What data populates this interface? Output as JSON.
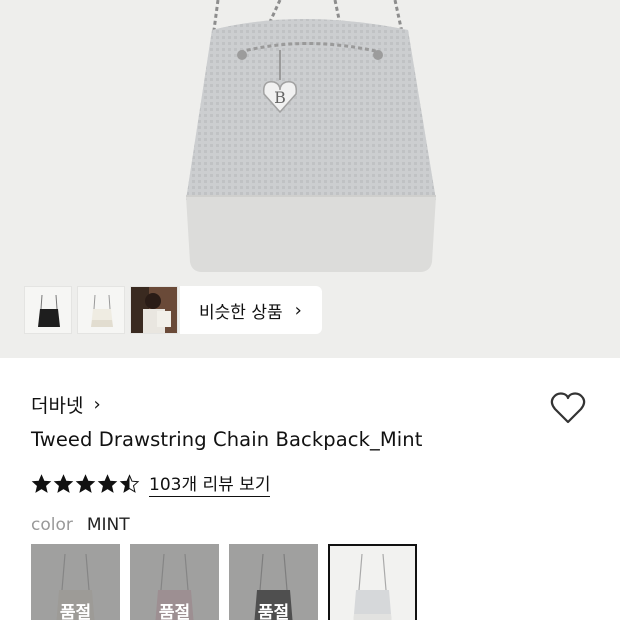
{
  "similar": {
    "label": "비슷한 상품",
    "chevron": "›"
  },
  "product": {
    "brand": "더바넷",
    "brand_chevron": "›",
    "title": "Tweed Drawstring Chain Backpack_Mint",
    "rating": 4.5,
    "review_link": "103개 리뷰 보기",
    "color_label": "color",
    "color_value": "MINT"
  },
  "options": [
    {
      "status": "품절"
    },
    {
      "status": "품절"
    },
    {
      "status": "품절"
    }
  ],
  "colors": {
    "hero_bg": "#eeeeec",
    "tweed": "#c9cbcd",
    "leather_base": "#dcdcda",
    "star": "#111111",
    "soldout_overlay": "#6e6e6e"
  },
  "icons": [
    "heart-icon",
    "star-icon",
    "chevron-right-icon"
  ]
}
